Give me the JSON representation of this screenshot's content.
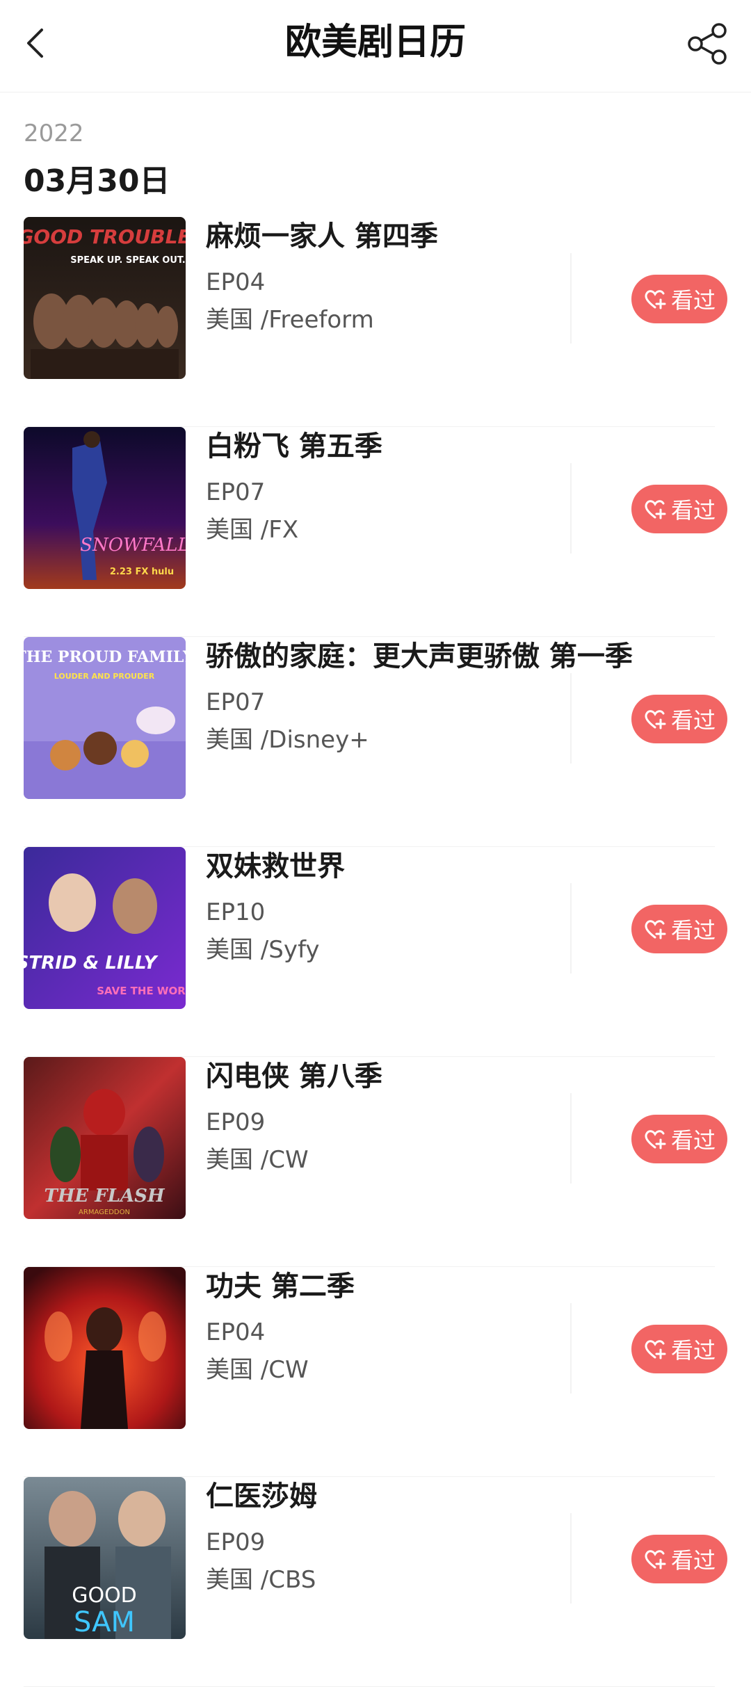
{
  "header": {
    "title": "欧美剧日历",
    "back_icon": "chevron-left-icon",
    "share_icon": "share-icon"
  },
  "calendar": {
    "year": "2022",
    "date": "03月30日"
  },
  "colors": {
    "accent": "#f26564",
    "text_primary": "#1a1a1a",
    "text_secondary": "#555555",
    "text_muted": "#9a9a9a"
  },
  "items": [
    {
      "title": "麻烦一家人 第四季",
      "episode": "EP04",
      "network": "美国 /Freeform",
      "button_label": "看过",
      "poster_text": "GOOD TROUBLE",
      "poster_subtext": "SPEAK UP. SPEAK OUT."
    },
    {
      "title": "白粉飞 第五季",
      "episode": "EP07",
      "network": "美国 /FX",
      "button_label": "看过",
      "poster_text": "SNOWFALL",
      "poster_subtext": "2.23 FX hulu"
    },
    {
      "title": "骄傲的家庭：更大声更骄傲 第一季",
      "episode": "EP07",
      "network": "美国 /Disney+",
      "button_label": "看过",
      "poster_text": "THE PROUD FAMILY",
      "poster_subtext": "LOUDER AND PROUDER"
    },
    {
      "title": "双妹救世界",
      "episode": "EP10",
      "network": "美国 /Syfy",
      "button_label": "看过",
      "poster_text": "ASTRID & LILLY",
      "poster_subtext": "SAVE THE WORLD"
    },
    {
      "title": "闪电侠 第八季",
      "episode": "EP09",
      "network": "美国 /CW",
      "button_label": "看过",
      "poster_text": "THE FLASH",
      "poster_subtext": "ARMAGEDDON"
    },
    {
      "title": "功夫 第二季",
      "episode": "EP04",
      "network": "美国 /CW",
      "button_label": "看过",
      "poster_text": "",
      "poster_subtext": ""
    },
    {
      "title": "仁医莎姆",
      "episode": "EP09",
      "network": "美国 /CBS",
      "button_label": "看过",
      "poster_text": "GOOD",
      "poster_subtext": "SAM"
    }
  ]
}
